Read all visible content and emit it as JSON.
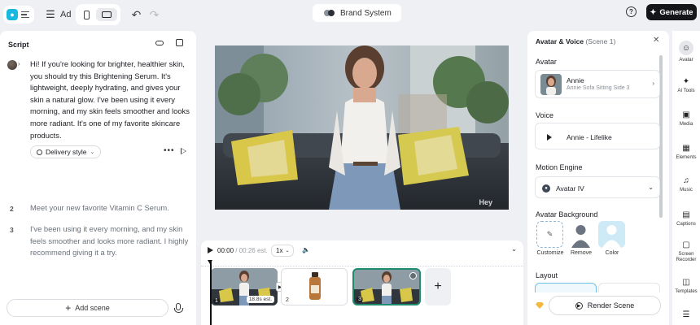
{
  "toolbar": {
    "ad_label": "Ad",
    "brand_label": "Brand System",
    "help_label": "?",
    "generate_label": "Generate"
  },
  "script": {
    "title": "Script",
    "scene1_text": "Hi! If you're looking for brighter, healthier skin, you should try this Brightening Serum. It's lightweight, deeply hydrating, and gives your skin a natural glow. I've been using it every morning, and my skin feels smoother and looks more radiant. It's one of my favorite skincare products.",
    "delivery_style": "Delivery style",
    "scenes": [
      {
        "num": "2",
        "text": "Meet your new favorite Vitamin C Serum."
      },
      {
        "num": "3",
        "text": "I've been using it every morning, and my skin feels smoother and looks more radiant. I highly recommend giving it a try."
      }
    ],
    "add_scene": "Add scene"
  },
  "video": {
    "watermark": "Hey"
  },
  "timeline": {
    "current_time": "00:00",
    "est_time": "/ 00:26 est.",
    "speed": "1x",
    "clips": [
      {
        "num": "1",
        "duration": "18.8s est."
      },
      {
        "num": "2"
      },
      {
        "num": "3"
      }
    ]
  },
  "panel": {
    "title": "Avatar & Voice",
    "scene_ref": "(Scene 1)",
    "avatar_label": "Avatar",
    "avatar_name": "Annie",
    "avatar_sub": "Annie Sofa Sitting Side 3",
    "voice_label": "Voice",
    "voice_name": "Annie - Lifelike",
    "engine_label": "Motion Engine",
    "engine_name": "Avatar IV",
    "bg_label": "Avatar Background",
    "bg_options": [
      "Customize",
      "Remove",
      "Color"
    ],
    "layout_label": "Layout",
    "render_label": "Render Scene"
  },
  "rail": {
    "items": [
      "Avatar",
      "AI Tools",
      "Media",
      "Elements",
      "Music",
      "Captions",
      "Screen Recorder",
      "Templates"
    ]
  },
  "colors": {
    "accent": "#18b8e0",
    "primary_button": "#141619",
    "selected_clip": "#1f8c6e"
  }
}
